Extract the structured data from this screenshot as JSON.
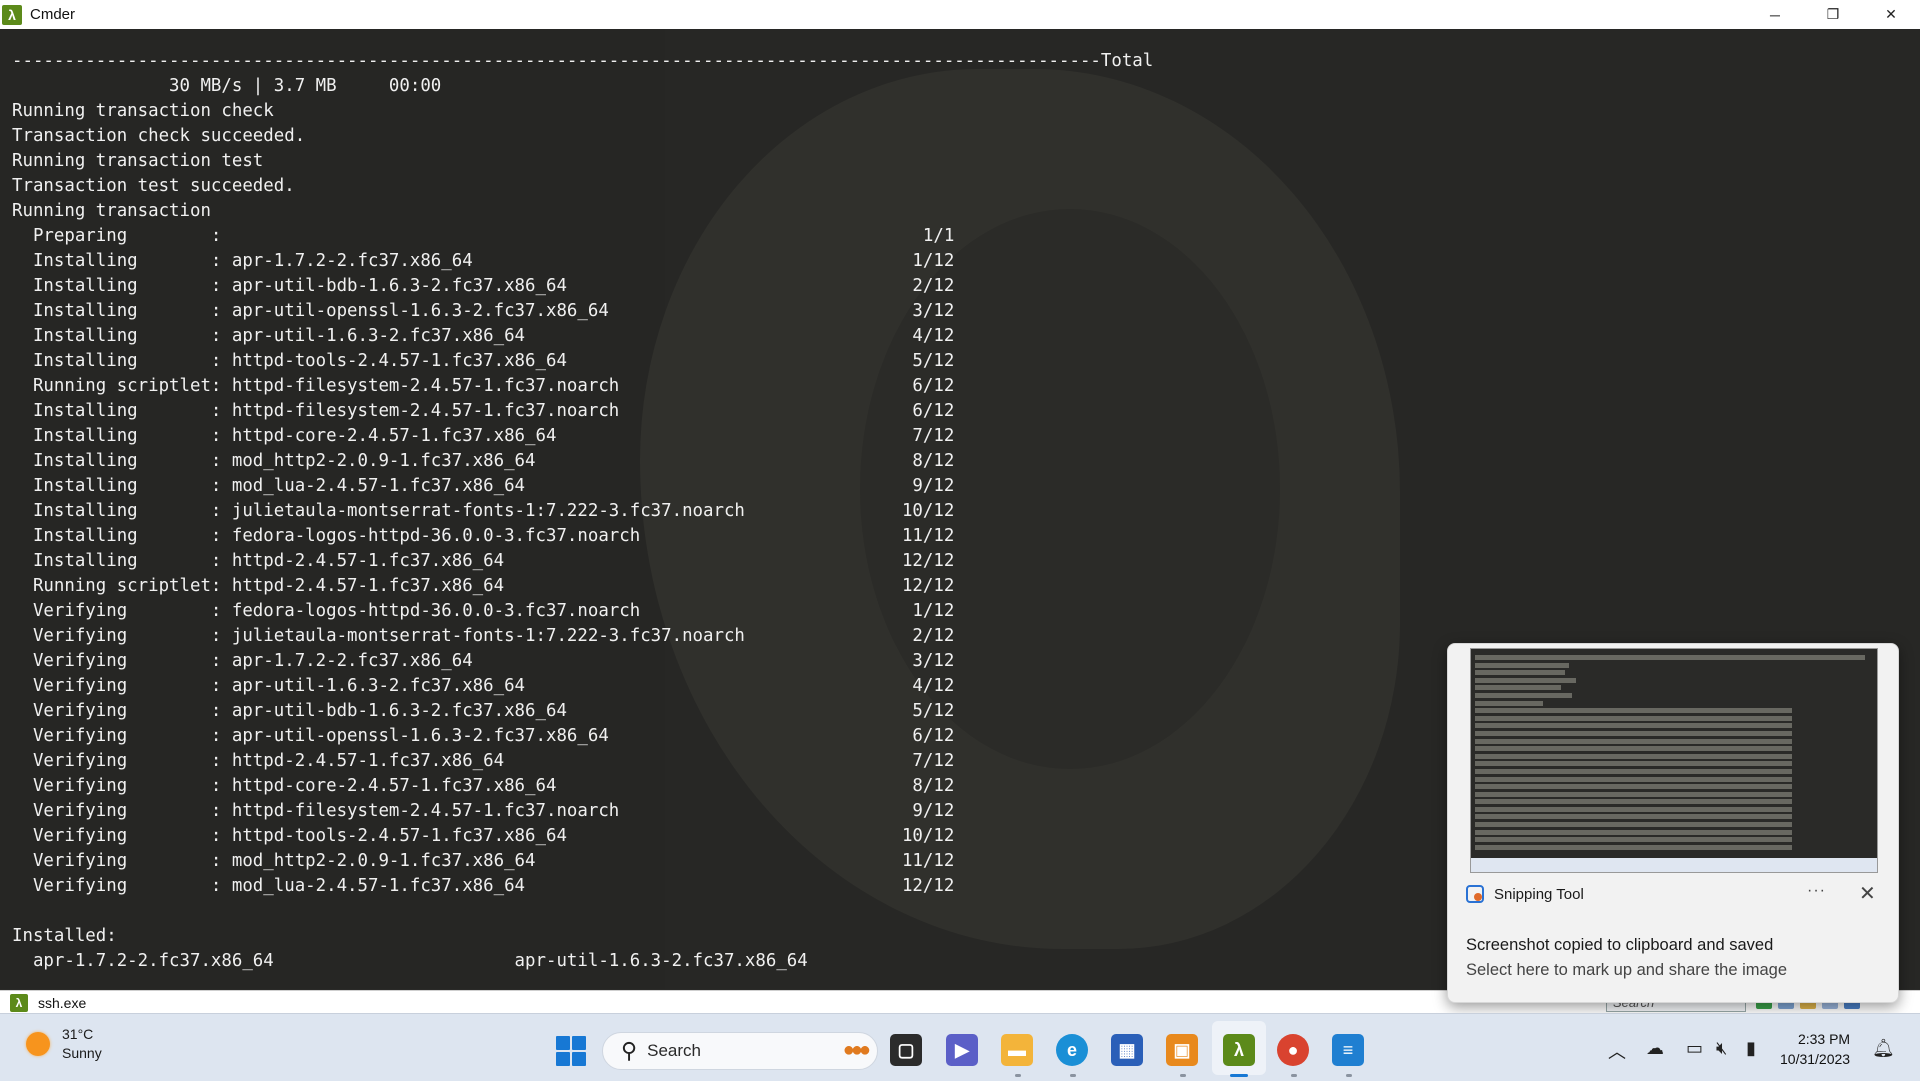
{
  "window": {
    "title": "Cmder",
    "minimize_glyph": "─",
    "maximize_glyph": "❐",
    "close_glyph": "✕"
  },
  "terminal": {
    "lines": [
      "--------------------------------------------------------------------------------------------------------Total",
      "               30 MB/s | 3.7 MB     00:00",
      "Running transaction check",
      "Transaction check succeeded.",
      "Running transaction test",
      "Transaction test succeeded.",
      "Running transaction",
      "  Preparing        :                                                                   1/1",
      "  Installing       : apr-1.7.2-2.fc37.x86_64                                          1/12",
      "  Installing       : apr-util-bdb-1.6.3-2.fc37.x86_64                                 2/12",
      "  Installing       : apr-util-openssl-1.6.3-2.fc37.x86_64                             3/12",
      "  Installing       : apr-util-1.6.3-2.fc37.x86_64                                     4/12",
      "  Installing       : httpd-tools-2.4.57-1.fc37.x86_64                                 5/12",
      "  Running scriptlet: httpd-filesystem-2.4.57-1.fc37.noarch                            6/12",
      "  Installing       : httpd-filesystem-2.4.57-1.fc37.noarch                            6/12",
      "  Installing       : httpd-core-2.4.57-1.fc37.x86_64                                  7/12",
      "  Installing       : mod_http2-2.0.9-1.fc37.x86_64                                    8/12",
      "  Installing       : mod_lua-2.4.57-1.fc37.x86_64                                     9/12",
      "  Installing       : julietaula-montserrat-fonts-1:7.222-3.fc37.noarch               10/12",
      "  Installing       : fedora-logos-httpd-36.0.0-3.fc37.noarch                         11/12",
      "  Installing       : httpd-2.4.57-1.fc37.x86_64                                      12/12",
      "  Running scriptlet: httpd-2.4.57-1.fc37.x86_64                                      12/12",
      "  Verifying        : fedora-logos-httpd-36.0.0-3.fc37.noarch                          1/12",
      "  Verifying        : julietaula-montserrat-fonts-1:7.222-3.fc37.noarch                2/12",
      "  Verifying        : apr-1.7.2-2.fc37.x86_64                                          3/12",
      "  Verifying        : apr-util-1.6.3-2.fc37.x86_64                                     4/12",
      "  Verifying        : apr-util-bdb-1.6.3-2.fc37.x86_64                                 5/12",
      "  Verifying        : apr-util-openssl-1.6.3-2.fc37.x86_64                             6/12",
      "  Verifying        : httpd-2.4.57-1.fc37.x86_64                                       7/12",
      "  Verifying        : httpd-core-2.4.57-1.fc37.x86_64                                  8/12",
      "  Verifying        : httpd-filesystem-2.4.57-1.fc37.noarch                            9/12",
      "  Verifying        : httpd-tools-2.4.57-1.fc37.x86_64                                10/12",
      "  Verifying        : mod_http2-2.0.9-1.fc37.x86_64                                   11/12",
      "  Verifying        : mod_lua-2.4.57-1.fc37.x86_64                                    12/12",
      "",
      "Installed:",
      "  apr-1.7.2-2.fc37.x86_64                       apr-util-1.6.3-2.fc37.x86_64"
    ]
  },
  "statusbar": {
    "tab_label": "ssh.exe",
    "search_placeholder": "Search"
  },
  "toast": {
    "app_name": "Snipping Tool",
    "more_glyph": "···",
    "close_glyph": "✕",
    "title": "Screenshot copied to clipboard and saved",
    "body": "Select here to mark up and share the image"
  },
  "taskbar": {
    "weather_temp": "31°C",
    "weather_desc": "Sunny",
    "search_label": "Search",
    "time": "2:33 PM",
    "date": "10/31/2023"
  },
  "colors": {
    "terminal_bg": "#272725",
    "terminal_fg": "#f0f0f0",
    "accent": "#1778d4",
    "cmder_green": "#5c8a1a"
  }
}
